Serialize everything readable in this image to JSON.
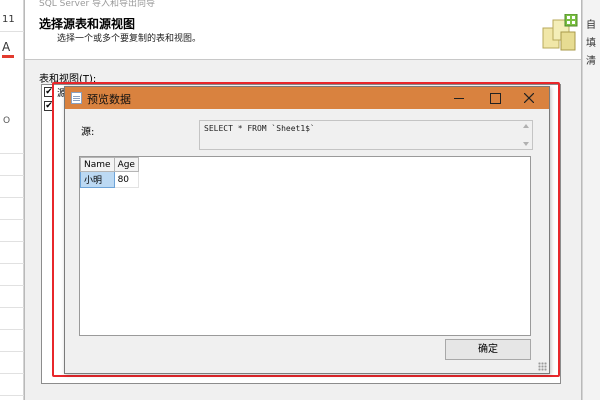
{
  "excel": {
    "font_size": "11",
    "font_color_glyph": "A",
    "name_box": "O",
    "ribbon_right_labels": [
      "自",
      "填",
      "清"
    ]
  },
  "wizard": {
    "window_title": "SQL Server 导入和导出向导",
    "page_title": "选择源表和源视图",
    "page_subtitle": "选择一个或多个要复制的表和视图。",
    "table_list_label": "表和视图(T):",
    "rows": [
      {
        "checked": true,
        "label": "源"
      },
      {
        "checked": true,
        "label": ""
      }
    ]
  },
  "highlight_color": "#e8272b",
  "dialog": {
    "title": "预览数据",
    "titlebar_color": "#d9823f",
    "source_label": "源:",
    "query": "SELECT * FROM `Sheet1$`",
    "grid": {
      "columns": [
        "Name",
        "Age"
      ],
      "rows": [
        [
          "小明",
          "80"
        ]
      ]
    },
    "ok_label": "确定"
  },
  "icons": {
    "minimize": "minimize-icon",
    "maximize": "maximize-icon",
    "close": "close-icon",
    "app": "document-icon"
  }
}
